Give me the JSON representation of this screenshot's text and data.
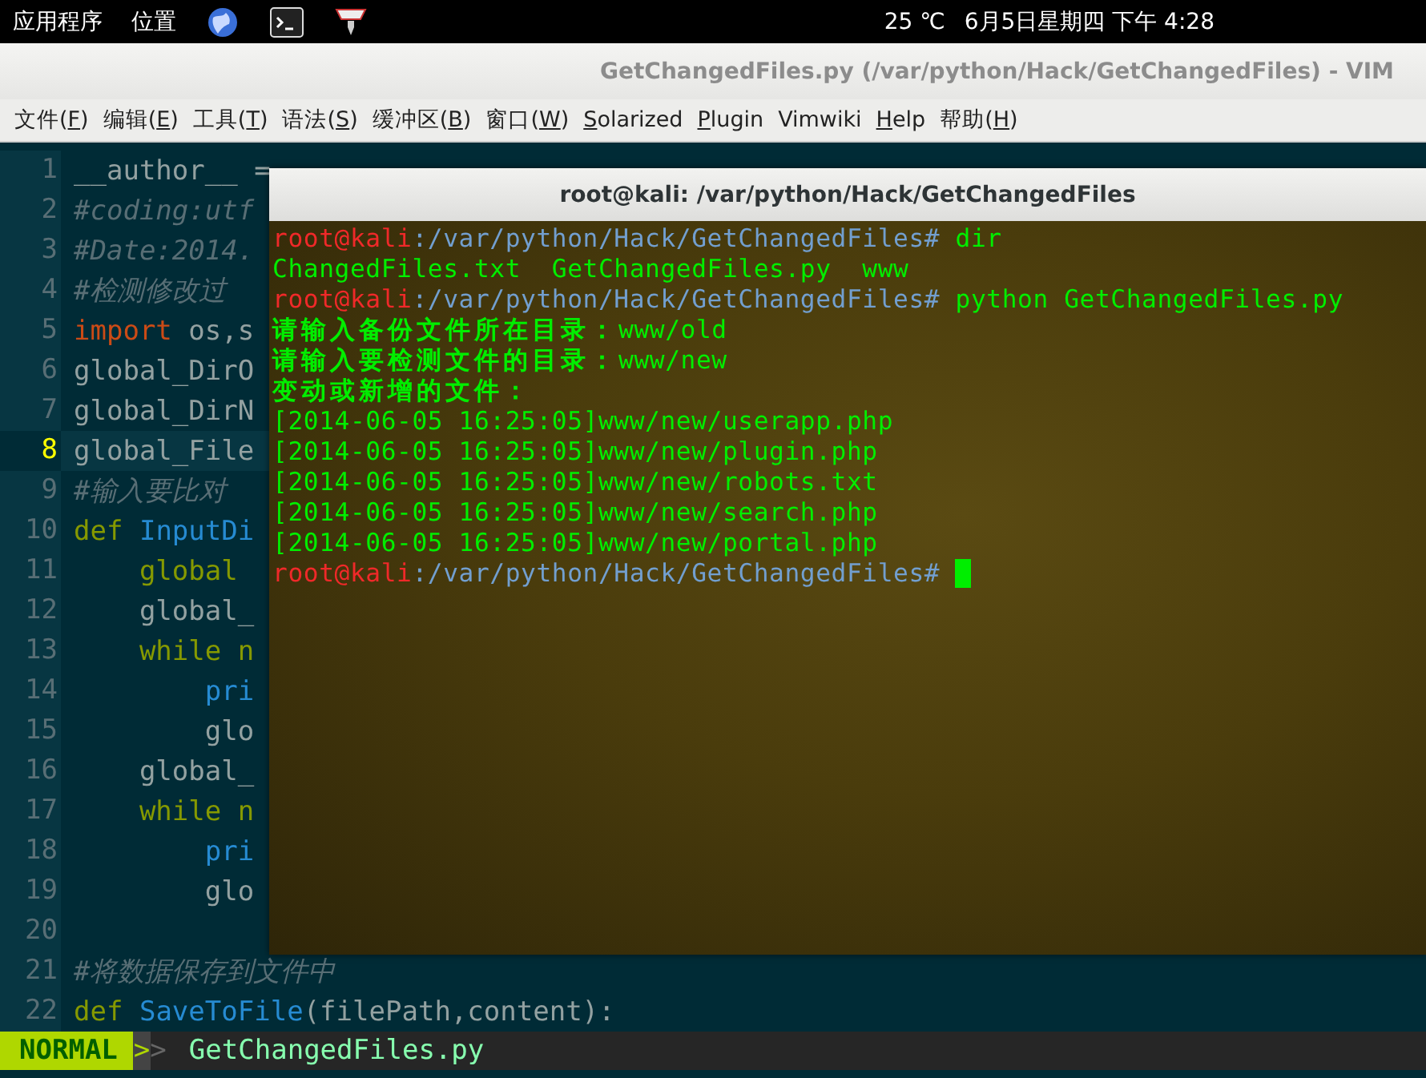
{
  "top_panel": {
    "menus": [
      "应用程序",
      "位置"
    ],
    "launchers": [
      {
        "kind": "browser"
      },
      {
        "kind": "terminal"
      },
      {
        "kind": "tool"
      }
    ],
    "weather": "25 ℃",
    "clock": "6月5日星期四 下午 4:28"
  },
  "window": {
    "title": "GetChangedFiles.py (/var/python/Hack/GetChangedFiles) - VIM"
  },
  "menu_bar": [
    {
      "pre": "文件(",
      "key": "F",
      "post": ")"
    },
    {
      "pre": "编辑(",
      "key": "E",
      "post": ")"
    },
    {
      "pre": "工具(",
      "key": "T",
      "post": ")"
    },
    {
      "pre": "语法(",
      "key": "S",
      "post": ")"
    },
    {
      "pre": "缓冲区(",
      "key": "B",
      "post": ")"
    },
    {
      "pre": "窗口(",
      "key": "W",
      "post": ")"
    },
    {
      "key": "S",
      "post": "olarized"
    },
    {
      "key": "P",
      "post": "lugin"
    },
    {
      "pre": "Vimwiki"
    },
    {
      "key": "H",
      "post": "elp"
    },
    {
      "pre": "帮助(",
      "key": "H",
      "post": ")"
    }
  ],
  "editor": {
    "lines": [
      {
        "number": "1",
        "current": false,
        "segments": [
          {
            "kind": "normal",
            "text": "__author__ ="
          }
        ]
      },
      {
        "number": "2",
        "current": false,
        "segments": [
          {
            "kind": "comment",
            "text": "#coding:utf"
          }
        ]
      },
      {
        "number": "3",
        "current": false,
        "segments": [
          {
            "kind": "comment",
            "text": "#Date:2014."
          }
        ]
      },
      {
        "number": "4",
        "current": false,
        "segments": [
          {
            "kind": "comment",
            "text": "#检测修改过"
          }
        ]
      },
      {
        "number": "5",
        "current": false,
        "segments": [
          {
            "kind": "import",
            "text": "import"
          },
          {
            "kind": "normal",
            "text": " os,s"
          }
        ]
      },
      {
        "number": "6",
        "current": false,
        "segments": [
          {
            "kind": "normal",
            "text": "global_DirO"
          }
        ]
      },
      {
        "number": "7",
        "current": false,
        "segments": [
          {
            "kind": "normal",
            "text": "global_DirN"
          }
        ]
      },
      {
        "number": "8",
        "current": true,
        "segments": [
          {
            "kind": "normal",
            "text": "global_File"
          }
        ]
      },
      {
        "number": "9",
        "current": false,
        "segments": [
          {
            "kind": "comment",
            "text": "#输入要比对"
          }
        ]
      },
      {
        "number": "10",
        "current": false,
        "segments": [
          {
            "kind": "keyword",
            "text": "def"
          },
          {
            "kind": "function",
            "text": " InputDi"
          }
        ]
      },
      {
        "number": "11",
        "current": false,
        "segments": [
          {
            "kind": "keyword",
            "text": "    global"
          }
        ]
      },
      {
        "number": "12",
        "current": false,
        "segments": [
          {
            "kind": "normal",
            "text": "    global_"
          }
        ]
      },
      {
        "number": "13",
        "current": false,
        "segments": [
          {
            "kind": "keyword",
            "text": "    while n"
          }
        ]
      },
      {
        "number": "14",
        "current": false,
        "segments": [
          {
            "kind": "function",
            "text": "        pri"
          }
        ]
      },
      {
        "number": "15",
        "current": false,
        "segments": [
          {
            "kind": "normal",
            "text": "        glo"
          }
        ]
      },
      {
        "number": "16",
        "current": false,
        "segments": [
          {
            "kind": "normal",
            "text": "    global_"
          }
        ]
      },
      {
        "number": "17",
        "current": false,
        "segments": [
          {
            "kind": "keyword",
            "text": "    while n"
          }
        ]
      },
      {
        "number": "18",
        "current": false,
        "segments": [
          {
            "kind": "function",
            "text": "        pri"
          }
        ]
      },
      {
        "number": "19",
        "current": false,
        "segments": [
          {
            "kind": "normal",
            "text": "        glo"
          }
        ]
      },
      {
        "number": "20",
        "current": false
      },
      {
        "number": "21",
        "current": false,
        "segments": [
          {
            "kind": "comment",
            "text": "#将数据保存到文件中"
          }
        ]
      },
      {
        "number": "22",
        "current": false,
        "segments": [
          {
            "kind": "keyword",
            "text": "def"
          },
          {
            "kind": "function",
            "text": " SaveToFile"
          },
          {
            "kind": "normal",
            "text": "(filePath,content):"
          }
        ]
      }
    ]
  },
  "status_line": {
    "mode": "NORMAL",
    "separator": ">",
    "separator_2": ">",
    "file": "GetChangedFiles.py"
  },
  "terminal": {
    "title": "root@kali: /var/python/Hack/GetChangedFiles",
    "lines": [
      [
        {
          "kind": "user",
          "text": "root@kali"
        },
        {
          "kind": "path",
          "text": ":/var/python/Hack/GetChangedFiles#"
        },
        {
          "kind": "output",
          "text": " dir"
        }
      ],
      [
        {
          "kind": "output",
          "text": "ChangedFiles.txt  GetChangedFiles.py  www"
        }
      ],
      [
        {
          "kind": "user",
          "text": "root@kali"
        },
        {
          "kind": "path",
          "text": ":/var/python/Hack/GetChangedFiles#"
        },
        {
          "kind": "output",
          "text": " python GetChangedFiles.py"
        }
      ],
      [
        {
          "kind": "cjk",
          "text": "请输入备份文件所在目录："
        },
        {
          "kind": "output",
          "text": "www/old"
        }
      ],
      [
        {
          "kind": "cjk",
          "text": "请输入要检测文件的目录："
        },
        {
          "kind": "output",
          "text": "www/new"
        }
      ],
      [
        {
          "kind": "cjk",
          "text": "变动或新增的文件："
        }
      ],
      [
        {
          "kind": "output",
          "text": "[2014-06-05 16:25:05]www/new/userapp.php"
        }
      ],
      [
        {
          "kind": "output",
          "text": "[2014-06-05 16:25:05]www/new/plugin.php"
        }
      ],
      [
        {
          "kind": "output",
          "text": "[2014-06-05 16:25:05]www/new/robots.txt"
        }
      ],
      [
        {
          "kind": "output",
          "text": "[2014-06-05 16:25:05]www/new/search.php"
        }
      ],
      [
        {
          "kind": "output",
          "text": "[2014-06-05 16:25:05]www/new/portal.php"
        }
      ],
      [
        {
          "kind": "user",
          "text": "root@kali"
        },
        {
          "kind": "path",
          "text": ":/var/python/Hack/GetChangedFiles# "
        },
        {
          "kind": "cursor"
        }
      ]
    ]
  }
}
